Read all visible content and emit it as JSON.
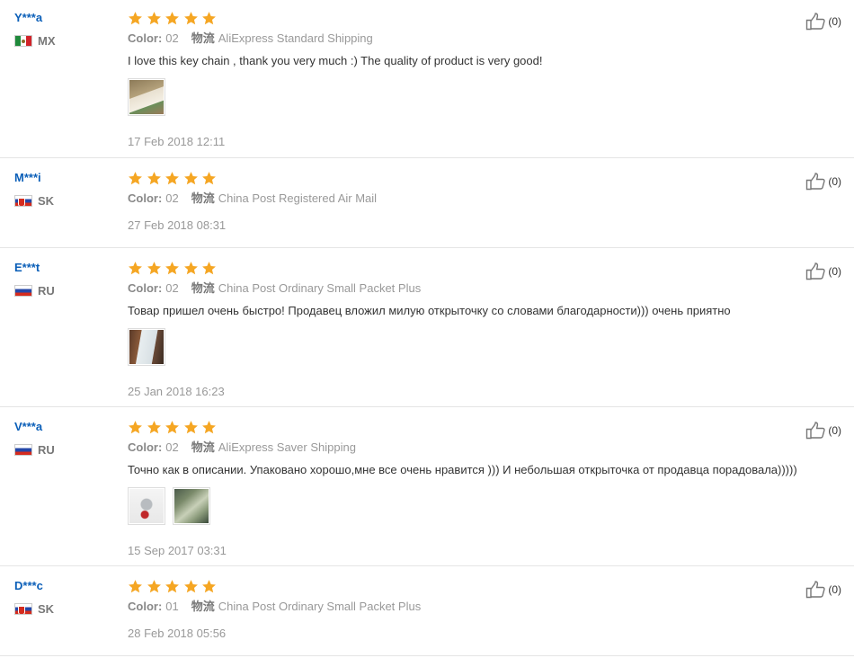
{
  "stars_color": "#f5a623",
  "color_label": "Color:",
  "shipping_label": "物流",
  "reviews": [
    {
      "user": "Y***a",
      "country": "MX",
      "color_value": "02",
      "shipping": "AliExpress Standard Shipping",
      "comment": "I love this key chain , thank you very much :) The quality of product is very good!",
      "date": "17 Feb 2018 12:11",
      "helpful_count": "(0)"
    },
    {
      "user": "M***i",
      "country": "SK",
      "color_value": "02",
      "shipping": "China Post Registered Air Mail",
      "comment": "",
      "date": "27 Feb 2018 08:31",
      "helpful_count": "(0)"
    },
    {
      "user": "E***t",
      "country": "RU",
      "color_value": "02",
      "shipping": "China Post Ordinary Small Packet Plus",
      "comment": "Товар пришел очень быстро! Продавец вложил милую открыточку со словами благодарности))) очень приятно",
      "date": "25 Jan 2018 16:23",
      "helpful_count": "(0)"
    },
    {
      "user": "V***a",
      "country": "RU",
      "color_value": "02",
      "shipping": "AliExpress Saver Shipping",
      "comment": "Точно как в описании. Упаковано хорошо,мне все очень нравится ))) И небольшая открыточка от продавца порадовала)))))",
      "date": "15 Sep 2017 03:31",
      "helpful_count": "(0)"
    },
    {
      "user": "D***c",
      "country": "SK",
      "color_value": "01",
      "shipping": "China Post Ordinary Small Packet Plus",
      "comment": "",
      "date": "28 Feb 2018 05:56",
      "helpful_count": "(0)"
    }
  ]
}
